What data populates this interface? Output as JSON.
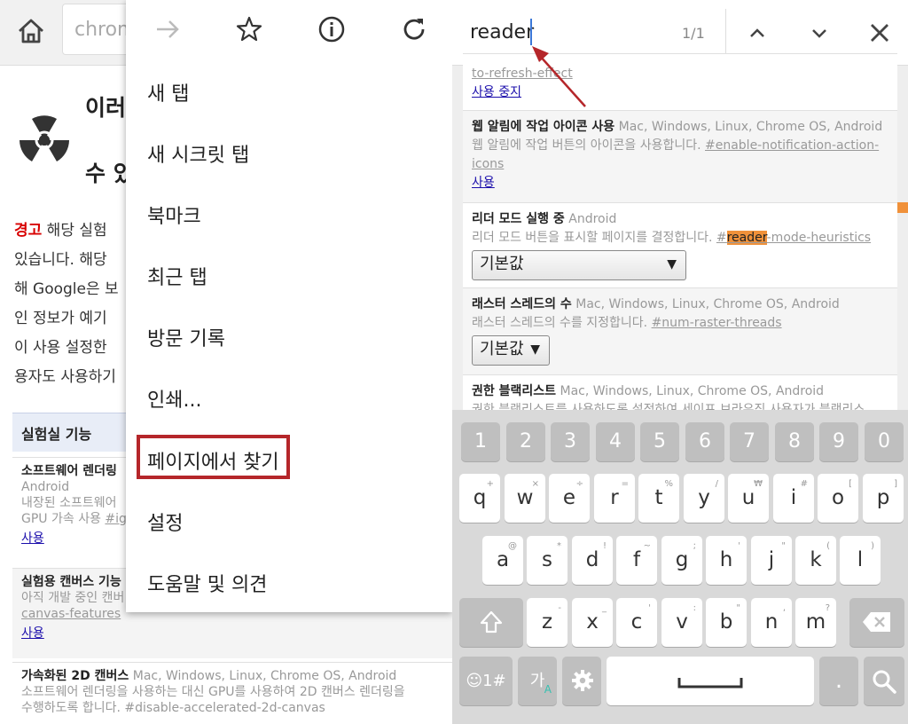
{
  "left": {
    "omnibox_text": "chrome",
    "title_line1": "이러",
    "title_line2": "수 있",
    "warning_label": "경고",
    "warning_rest_1": " 해당 실험",
    "warning_line2": "있습니다. 해당",
    "warning_line3": "해 Google은 보",
    "warning_line4": "인 정보가 예기",
    "warning_line5": "이 사용 설정한",
    "warning_line6": "용자도 사용하기",
    "lab_header": "실험실 기능",
    "items": [
      {
        "name": "소프트웨어 렌더링",
        "platform": "Android",
        "desc1": "내장된 소프트웨어",
        "desc2_pre": "GPU 가속 사용 ",
        "desc2_link": "#ig",
        "action": "사용"
      },
      {
        "name": "실험용 캔버스 기능",
        "desc1": "아직 개발 중인 캔버",
        "desc2": "canvas-features",
        "action": "사용"
      },
      {
        "name": "가속화된 2D 캔버스",
        "platform": "Mac, Windows, Linux, Chrome OS, Android",
        "desc1": "소프트웨어 렌더링을 사용하는 대신 GPU를 사용하여 2D 캔버스 렌더링을",
        "desc2": "수행하도록 합니다. #disable-accelerated-2d-canvas"
      }
    ]
  },
  "menu": {
    "items": [
      "새 탭",
      "새 시크릿 탭",
      "북마크",
      "최근 탭",
      "방문 기록",
      "인쇄...",
      "페이지에서 찾기",
      "설정",
      "도움말 및 의견"
    ]
  },
  "findbar": {
    "query": "reader",
    "count": "1/1"
  },
  "flags": [
    {
      "desc_tail": "to-refresh-effect",
      "action": "사용 중지"
    },
    {
      "name": "웹 알림에 작업 아이콘 사용",
      "platform": "Mac, Windows, Linux, Chrome OS, Android",
      "desc": "웹 알림에 작업 버튼의 아이콘을 사용합니다. ",
      "tag1": "#enable-notification-action-",
      "tag2": "icons",
      "action": "사용"
    },
    {
      "name": "리더 모드 실행 중",
      "platform": "Android",
      "desc": "리더 모드 버튼을 표시할 페이지를 결정합니다. ",
      "tag_pre": "#",
      "tag_match": "reader",
      "tag_post": "-mode-heuristics",
      "select": "기본값"
    },
    {
      "name": "래스터 스레드의 수",
      "platform": "Mac, Windows, Linux, Chrome OS, Android",
      "desc": "래스터 스레드의 수를 지정합니다. ",
      "tag": "#num-raster-threads",
      "select": "기본값"
    },
    {
      "name": "권한 블랙리스트",
      "platform": "Mac, Windows, Linux, Chrome OS, Android",
      "desc": "권한 블랙리스트를 사용하도록 설정하여 세이프 브라우징 사용자가 블랙리스"
    }
  ],
  "keyboard": {
    "numbers": [
      "1",
      "2",
      "3",
      "4",
      "5",
      "6",
      "7",
      "8",
      "9",
      "0"
    ],
    "row1": [
      "q",
      "w",
      "e",
      "r",
      "t",
      "y",
      "u",
      "i",
      "o",
      "p"
    ],
    "row1_sub": [
      "+",
      "×",
      "÷",
      "=",
      "%",
      "/",
      "₩",
      "#",
      "[",
      "]"
    ],
    "row2": [
      "a",
      "s",
      "d",
      "f",
      "g",
      "h",
      "j",
      "k",
      "l"
    ],
    "row2_sub": [
      "@",
      "*",
      "!",
      "~",
      ";",
      "'",
      "\"",
      "(",
      ")"
    ],
    "row3": [
      "z",
      "x",
      "c",
      "v",
      "b",
      "n",
      "m"
    ],
    "row3_sub": [
      "-",
      "_",
      "'",
      ":",
      "\"",
      ",",
      "?"
    ],
    "symbols_label": "☺1#",
    "lang_label": "가",
    "lang_sub": "A",
    "period": "."
  },
  "colors": {
    "accent_orange": "#f0913a",
    "warning_red": "#d80000",
    "highlight_box": "#b5262a",
    "caret_blue": "#3c78d8",
    "link_blue": "#1a0dab"
  }
}
